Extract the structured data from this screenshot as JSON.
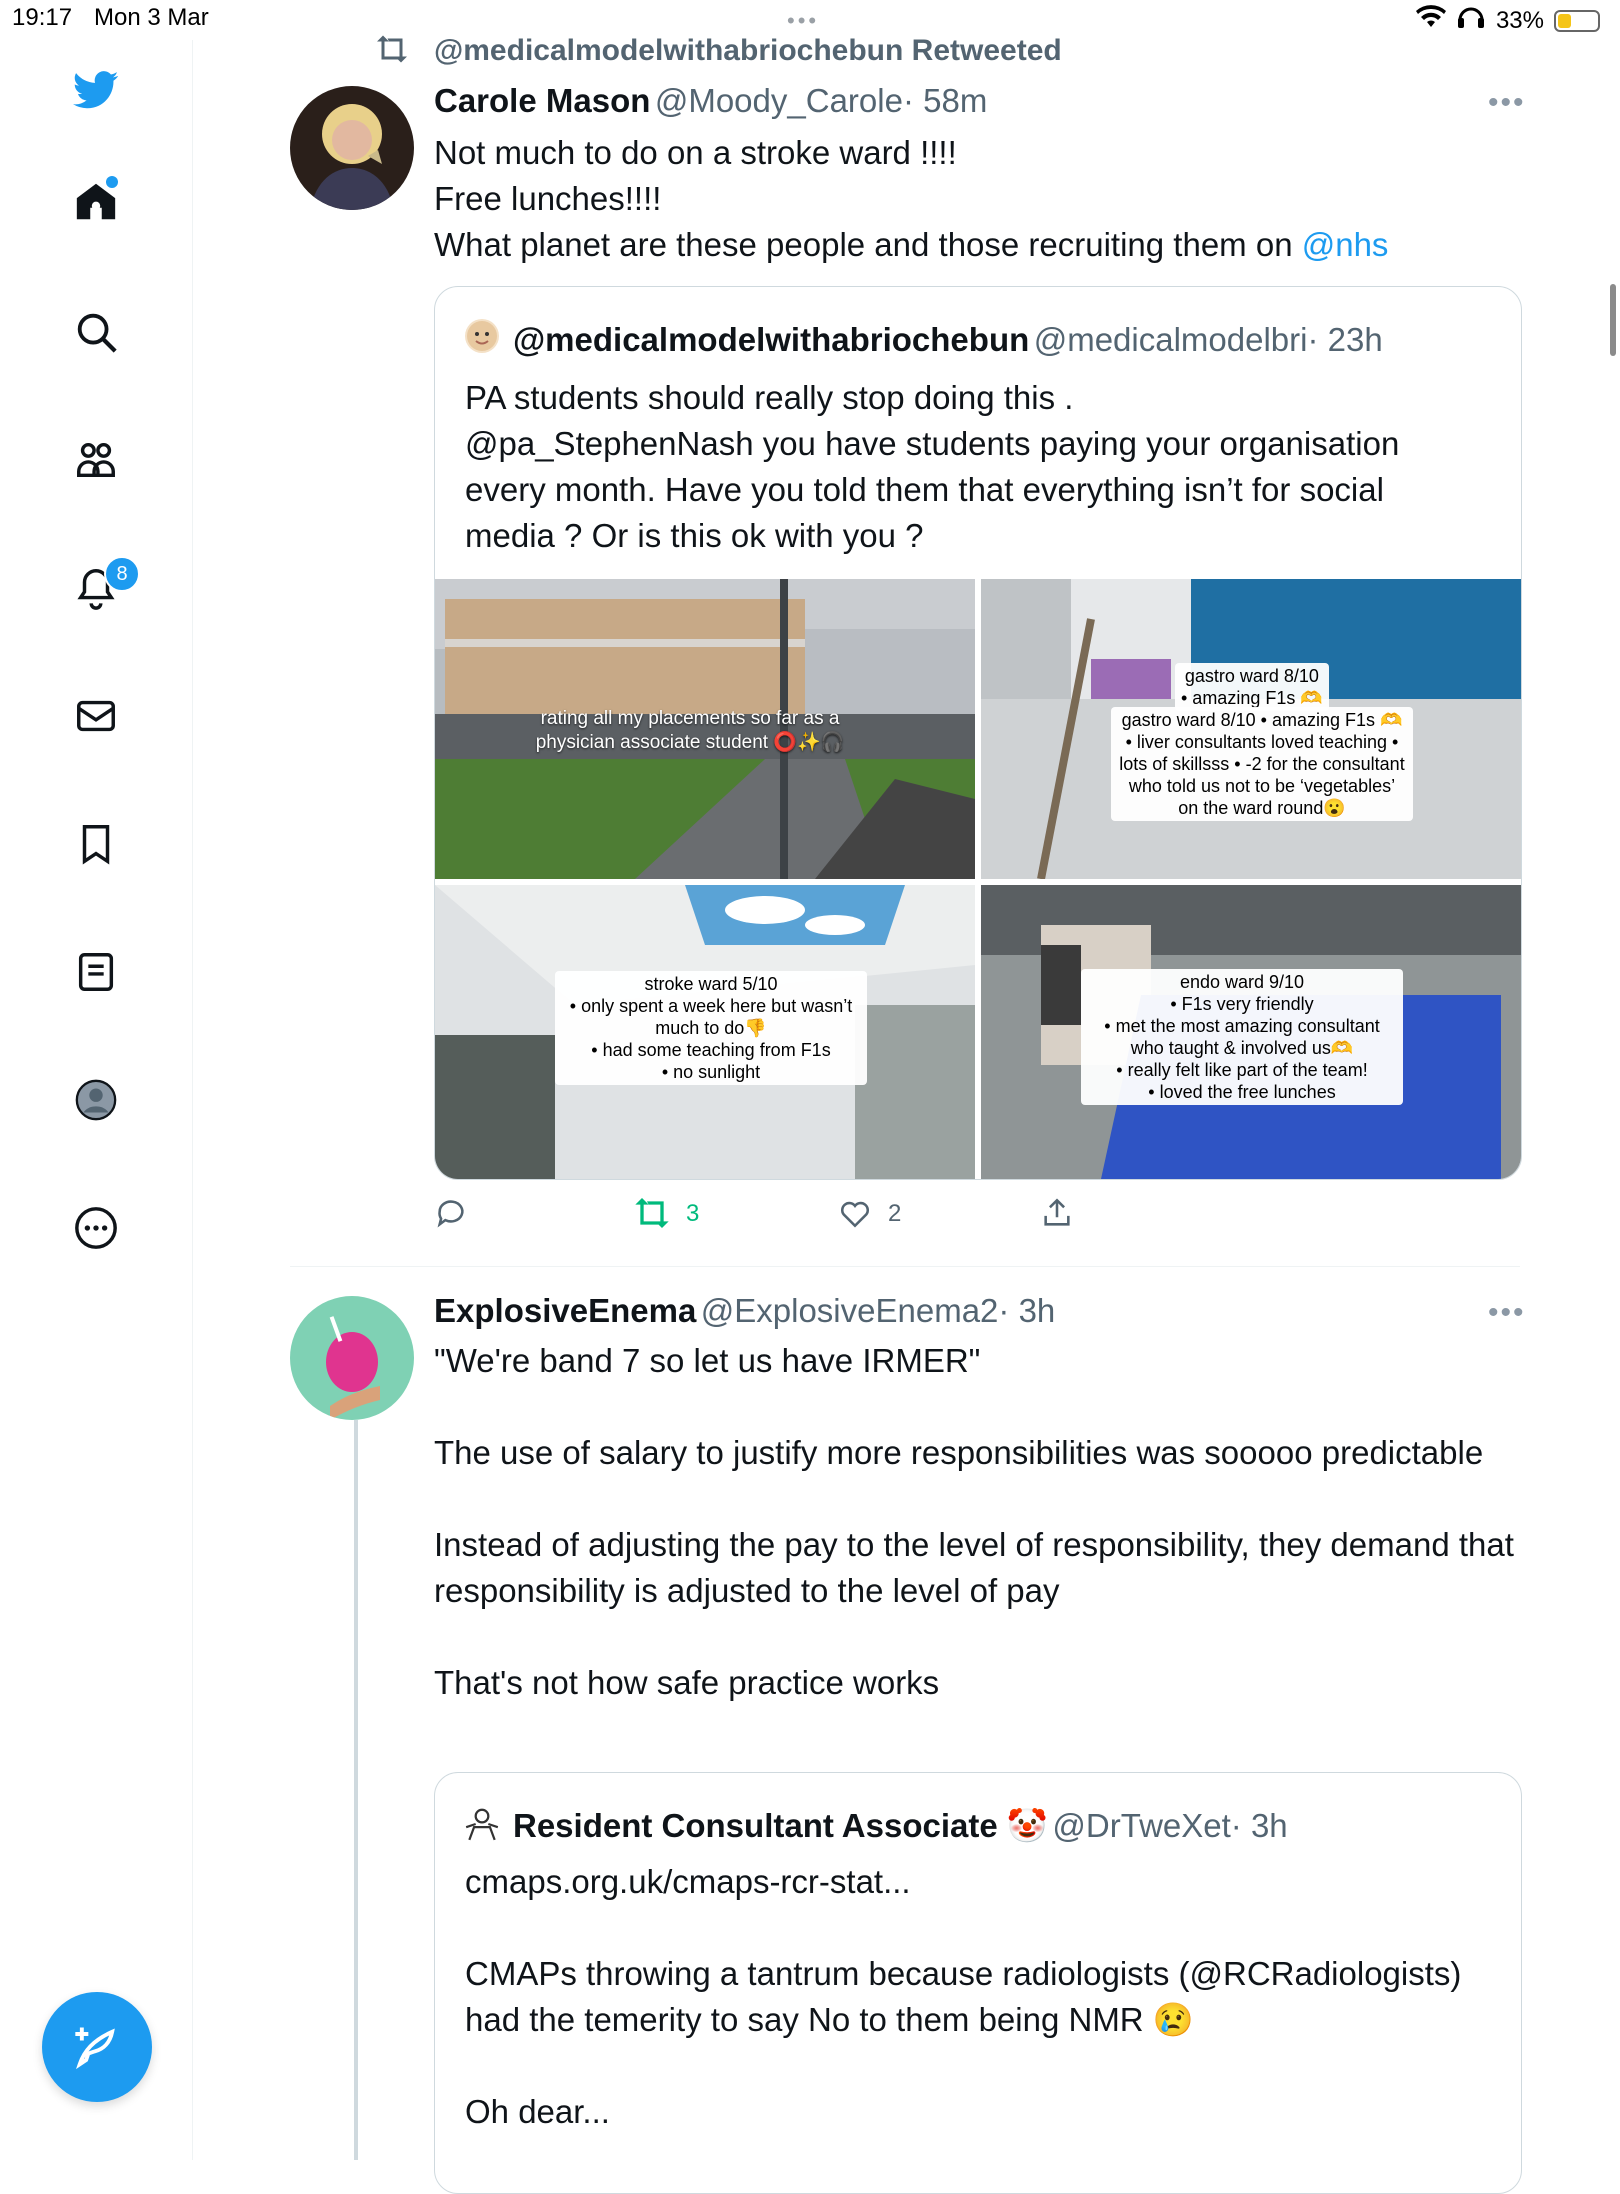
{
  "status_bar": {
    "time": "19:17",
    "date": "Mon 3 Mar",
    "battery": "33%"
  },
  "sidebar": {
    "items": [
      {
        "name": "twitter-logo-icon"
      },
      {
        "name": "home-icon"
      },
      {
        "name": "search-icon"
      },
      {
        "name": "communities-icon"
      },
      {
        "name": "notifications-icon"
      },
      {
        "name": "messages-icon"
      },
      {
        "name": "bookmarks-icon"
      },
      {
        "name": "lists-icon"
      },
      {
        "name": "profile-icon"
      },
      {
        "name": "more-icon"
      }
    ],
    "notification_count": "8",
    "accent": "#1d9bf0"
  },
  "tweet1": {
    "retweeted_by": "@medicalmodelwithabriochebun Retweeted",
    "name": "Carole Mason",
    "handle": "@Moody_Carole",
    "time": "· 58m",
    "text_lines": [
      "Not much to do on a stroke ward !!!!",
      "Free lunches!!!!",
      "What planet are these people and those recruiting them on "
    ],
    "mention": "@nhs",
    "quote": {
      "name": "@medicalmodelwithabriochebun",
      "handle": "@medicalmodelbri",
      "time": "· 23h",
      "text": "PA students should really stop doing this .\n@pa_StephenNash you have students paying your organisation every month. Have you told them that everything isn’t for social media ? Or is this ok with you ?",
      "images": [
        {
          "caption": "rating all my placements so far as a physician associate student ⭕✨🎧"
        },
        {
          "caption": "gastro ward 8/10\n• amazing F1s 🫶\n• liver consultants loved teaching\n• lots of skillsss\n• -2 for the consultant who told us not to be ‘vegetables’ on the ward round😮"
        },
        {
          "caption": "stroke ward 5/10\n• only spent a week here but wasn’t much to do👎\n• had some teaching from F1s\n• no sunlight"
        },
        {
          "caption": "endo ward 9/10\n• F1s very friendly\n• met the most amazing consultant who taught & involved us🫶\n• really felt like part of the team!\n• loved the free lunches"
        }
      ]
    },
    "actions": {
      "retweets": "3",
      "likes": "2"
    }
  },
  "tweet2": {
    "name": "ExplosiveEnema",
    "handle": "@ExplosiveEnema2",
    "time": "· 3h",
    "paragraphs": [
      "\"We're band 7 so let us have IRMER\"",
      "The use of salary to justify more responsibilities was sooooo predictable",
      "Instead of adjusting the pay to the level of responsibility, they demand that responsibility is adjusted to the level of pay",
      "That's not how safe practice works"
    ],
    "quote": {
      "name": "Resident Consultant Associate 🤡",
      "handle": "@DrTweXet",
      "time": "· 3h",
      "paragraphs": [
        "cmaps.org.uk/cmaps-rcr-stat...",
        "CMAPs throwing a tantrum because radiologists (@RCRadiologists) had the temerity to say No to them being NMR 😢",
        "Oh dear..."
      ]
    }
  }
}
